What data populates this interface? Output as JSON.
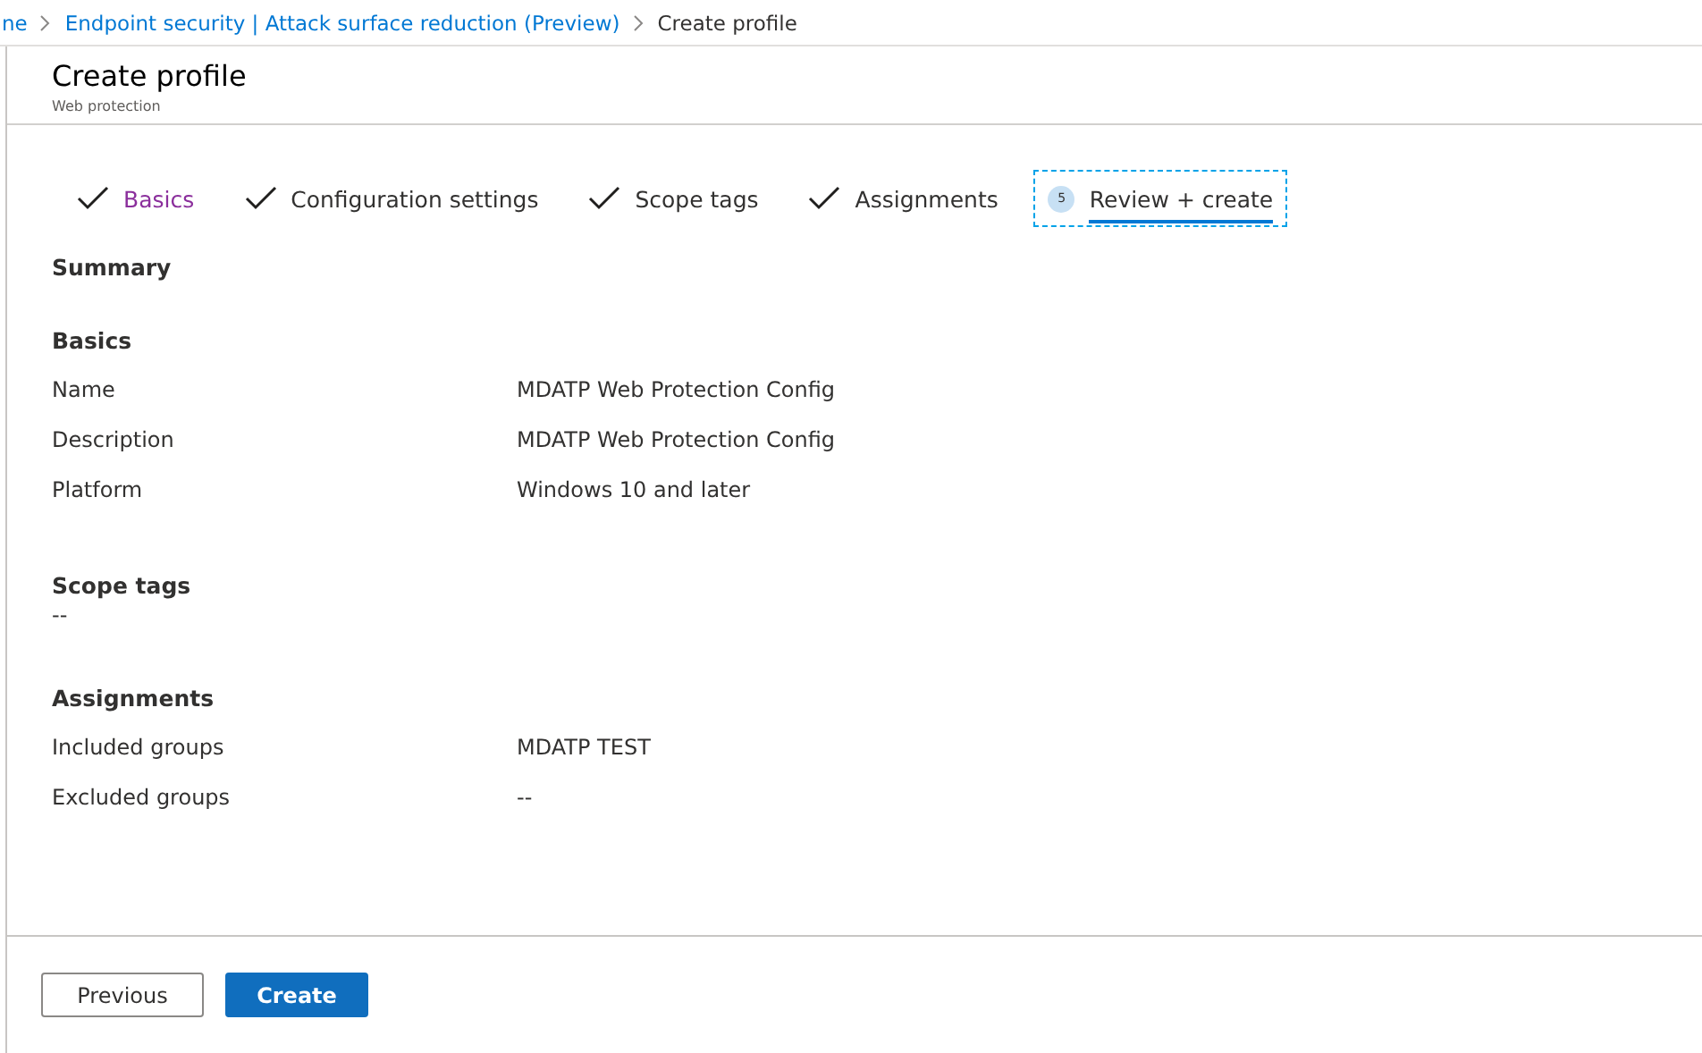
{
  "breadcrumb": [
    {
      "label": "ne",
      "link": true
    },
    {
      "label": "Endpoint security | Attack surface reduction (Preview)",
      "link": true
    },
    {
      "label": "Create profile",
      "link": false
    }
  ],
  "header": {
    "title": "Create profile",
    "subtitle": "Web protection"
  },
  "steps": [
    {
      "label": "Basics",
      "kind": "done",
      "visited": true,
      "selected": false
    },
    {
      "label": "Configuration settings",
      "kind": "done",
      "visited": false,
      "selected": false
    },
    {
      "label": "Scope tags",
      "kind": "done",
      "visited": false,
      "selected": false
    },
    {
      "label": "Assignments",
      "kind": "done",
      "visited": false,
      "selected": false
    },
    {
      "label": "Review + create",
      "kind": "current",
      "number": "5",
      "visited": false,
      "selected": true
    }
  ],
  "summary_title": "Summary",
  "sections": [
    {
      "title": "Basics",
      "kind": "table",
      "rows": [
        {
          "label": "Name",
          "value": "MDATP Web Protection Config"
        },
        {
          "label": "Description",
          "value": "MDATP Web Protection Config"
        },
        {
          "label": "Platform",
          "value": "Windows 10 and later"
        }
      ]
    },
    {
      "title": "Scope tags",
      "kind": "text",
      "value": "--"
    },
    {
      "title": "Assignments",
      "kind": "table",
      "rows": [
        {
          "label": "Included groups",
          "value": "MDATP TEST"
        },
        {
          "label": "Excluded groups",
          "value": "--"
        }
      ]
    }
  ],
  "buttons": [
    {
      "label": "Previous",
      "kind": "secondary"
    },
    {
      "label": "Create",
      "kind": "primary"
    }
  ]
}
